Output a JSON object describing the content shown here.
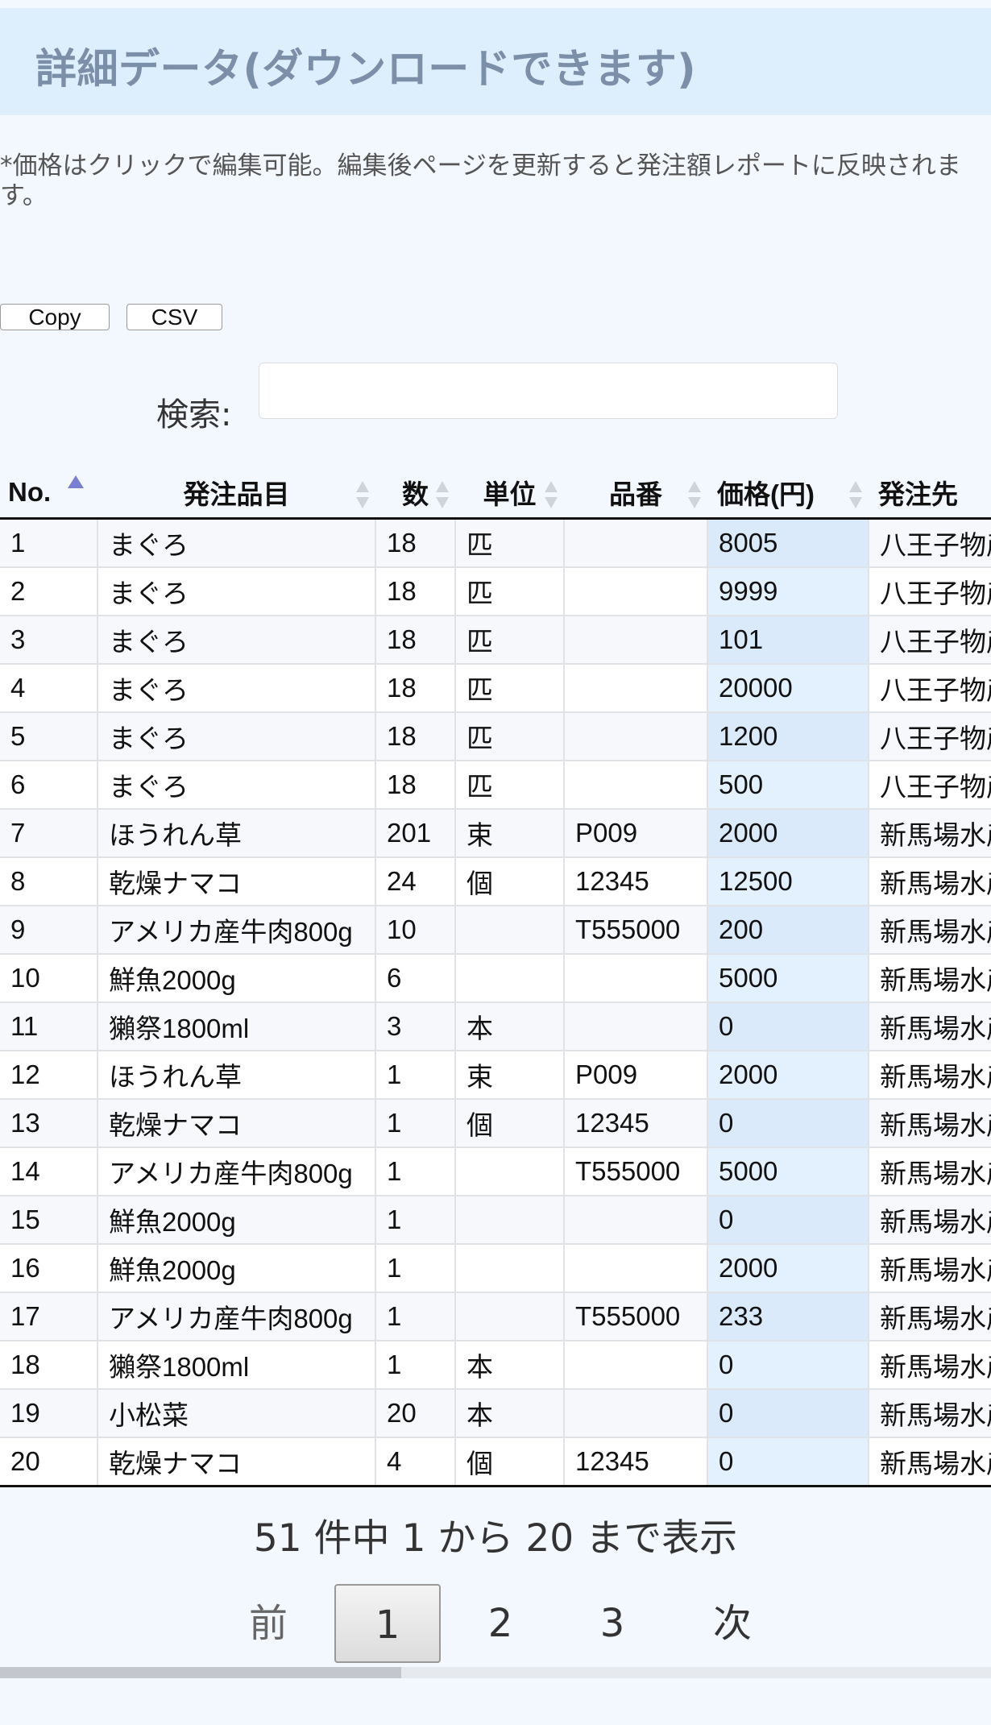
{
  "title": "詳細データ(ダウンロードできます)",
  "note": "*価格はクリックで編集可能。編集後ページを更新すると発注額レポートに反映されます。",
  "buttons": {
    "copy": "Copy",
    "csv": "CSV"
  },
  "search": {
    "label": "検索:",
    "value": ""
  },
  "table": {
    "headers": [
      "No.",
      "発注品目",
      "数",
      "単位",
      "品番",
      "価格(円)",
      "発注先"
    ],
    "sorted_column": "No.",
    "rows": [
      [
        "1",
        "まぐろ",
        "18",
        "匹",
        "",
        "8005",
        "八王子物産"
      ],
      [
        "2",
        "まぐろ",
        "18",
        "匹",
        "",
        "9999",
        "八王子物産"
      ],
      [
        "3",
        "まぐろ",
        "18",
        "匹",
        "",
        "101",
        "八王子物産"
      ],
      [
        "4",
        "まぐろ",
        "18",
        "匹",
        "",
        "20000",
        "八王子物産"
      ],
      [
        "5",
        "まぐろ",
        "18",
        "匹",
        "",
        "1200",
        "八王子物産"
      ],
      [
        "6",
        "まぐろ",
        "18",
        "匹",
        "",
        "500",
        "八王子物産"
      ],
      [
        "7",
        "ほうれん草",
        "201",
        "束",
        "P009",
        "2000",
        "新馬場水産"
      ],
      [
        "8",
        "乾燥ナマコ",
        "24",
        "個",
        "12345",
        "12500",
        "新馬場水産"
      ],
      [
        "9",
        "アメリカ産牛肉800g",
        "10",
        "",
        "T555000",
        "200",
        "新馬場水産"
      ],
      [
        "10",
        "鮮魚2000g",
        "6",
        "",
        "",
        "5000",
        "新馬場水産"
      ],
      [
        "11",
        "獺祭1800ml",
        "3",
        "本",
        "",
        "0",
        "新馬場水産"
      ],
      [
        "12",
        "ほうれん草",
        "1",
        "束",
        "P009",
        "2000",
        "新馬場水産"
      ],
      [
        "13",
        "乾燥ナマコ",
        "1",
        "個",
        "12345",
        "0",
        "新馬場水産"
      ],
      [
        "14",
        "アメリカ産牛肉800g",
        "1",
        "",
        "T555000",
        "5000",
        "新馬場水産"
      ],
      [
        "15",
        "鮮魚2000g",
        "1",
        "",
        "",
        "0",
        "新馬場水産"
      ],
      [
        "16",
        "鮮魚2000g",
        "1",
        "",
        "",
        "2000",
        "新馬場水産"
      ],
      [
        "17",
        "アメリカ産牛肉800g",
        "1",
        "",
        "T555000",
        "233",
        "新馬場水産"
      ],
      [
        "18",
        "獺祭1800ml",
        "1",
        "本",
        "",
        "0",
        "新馬場水産"
      ],
      [
        "19",
        "小松菜",
        "20",
        "本",
        "",
        "0",
        "新馬場水産"
      ],
      [
        "20",
        "乾燥ナマコ",
        "4",
        "個",
        "12345",
        "0",
        "新馬場水産"
      ]
    ]
  },
  "info": "51 件中 1 から 20 まで表示",
  "pagination": {
    "prev": "前",
    "pages": [
      "1",
      "2",
      "3"
    ],
    "current": "1",
    "next": "次"
  },
  "colors": {
    "title_bg": "#ddeefc",
    "title_text": "#7c8fa8",
    "price_column_bg": "#e3f0fd",
    "sort_active": "#7b7fd1",
    "sort_inactive": "#cfd3da"
  }
}
